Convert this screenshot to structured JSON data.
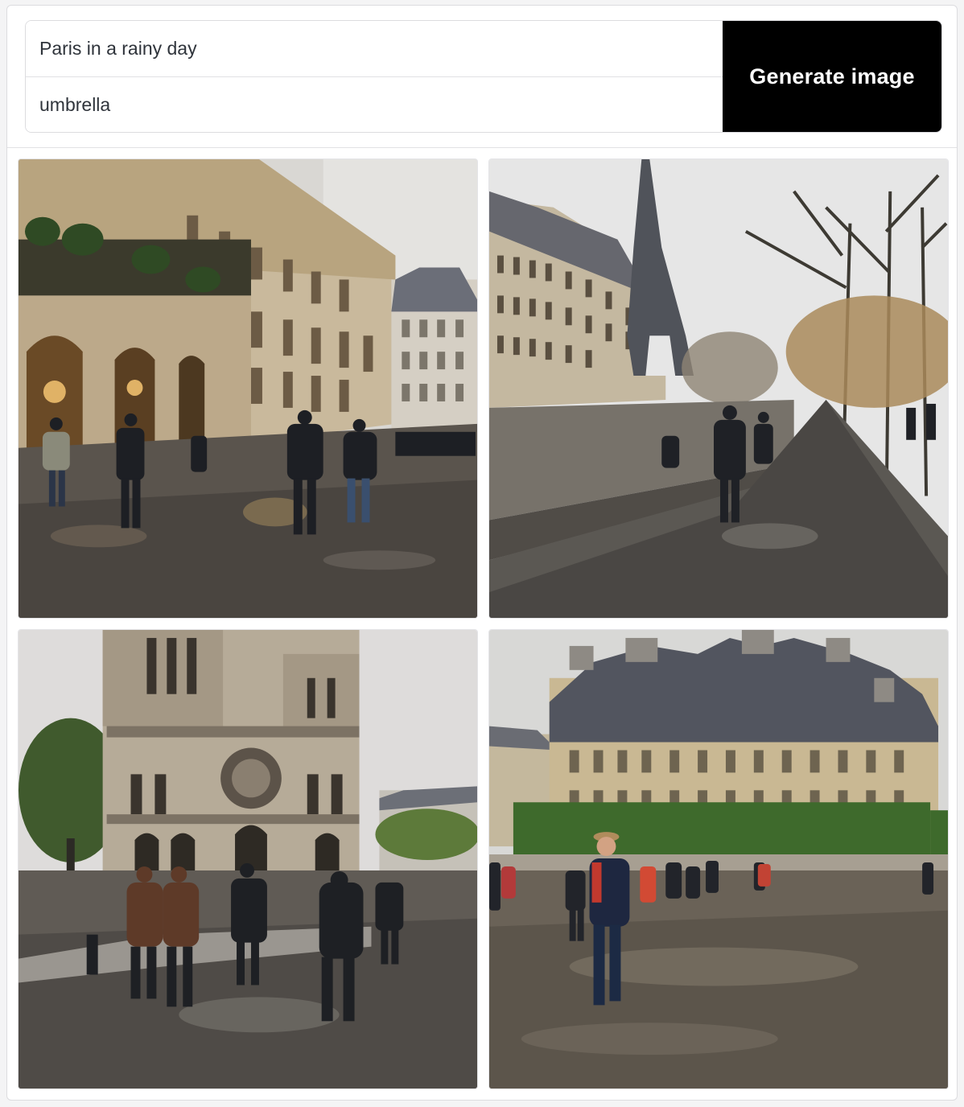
{
  "prompt": {
    "value": "Paris in a rainy day"
  },
  "negative_prompt": {
    "value": "umbrella"
  },
  "generate_button": {
    "label": "Generate image"
  },
  "gallery": {
    "images": [
      {
        "alt": "Rainy Paris street with ornate building facade and pedestrians"
      },
      {
        "alt": "Rainy riverside walkway with Eiffel Tower in the distance"
      },
      {
        "alt": "Notre-Dame cathedral on a rainy day with people walking"
      },
      {
        "alt": "Flooded square in front of a grand Parisian building"
      }
    ]
  }
}
